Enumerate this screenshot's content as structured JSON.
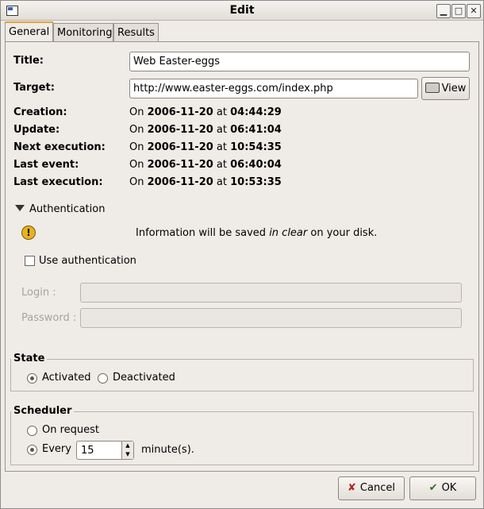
{
  "window": {
    "title": "Edit"
  },
  "tabs": [
    {
      "label": "General",
      "active": true
    },
    {
      "label": "Monitoring",
      "active": false
    },
    {
      "label": "Results",
      "active": false
    }
  ],
  "general": {
    "title_label": "Title:",
    "title_value": "Web Easter-eggs",
    "target_label": "Target:",
    "target_value": "http://www.easter-eggs.com/index.php",
    "view_button": "View",
    "dates": [
      {
        "label": "Creation:",
        "on": "On",
        "date": "2006-11-20",
        "at": "at",
        "time": "04:44:29"
      },
      {
        "label": "Update:",
        "on": "On",
        "date": "2006-11-20",
        "at": "at",
        "time": "06:41:04"
      },
      {
        "label": "Next execution:",
        "on": "On",
        "date": "2006-11-20",
        "at": "at",
        "time": "10:54:35"
      },
      {
        "label": "Last event:",
        "on": "On",
        "date": "2006-11-20",
        "at": "at",
        "time": "06:40:04"
      },
      {
        "label": "Last execution:",
        "on": "On",
        "date": "2006-11-20",
        "at": "at",
        "time": "10:53:35"
      }
    ]
  },
  "auth": {
    "expander": "Authentication",
    "warning_pre": "Information will be saved ",
    "warning_em": "in clear",
    "warning_post": " on your disk.",
    "use_auth": "Use authentication",
    "use_auth_checked": false,
    "login_label": "Login :",
    "password_label": "Password :"
  },
  "state": {
    "title": "State",
    "activated": "Activated",
    "deactivated": "Deactivated",
    "selected": "Activated"
  },
  "scheduler": {
    "title": "Scheduler",
    "on_request": "On request",
    "every": "Every",
    "every_value": "15",
    "unit": "minute(s).",
    "selected": "Every"
  },
  "buttons": {
    "cancel": "Cancel",
    "ok": "OK"
  },
  "colors": {
    "background": "#efebe7",
    "tab_accent": "#e4a33b",
    "warning": "#e8b21f"
  }
}
